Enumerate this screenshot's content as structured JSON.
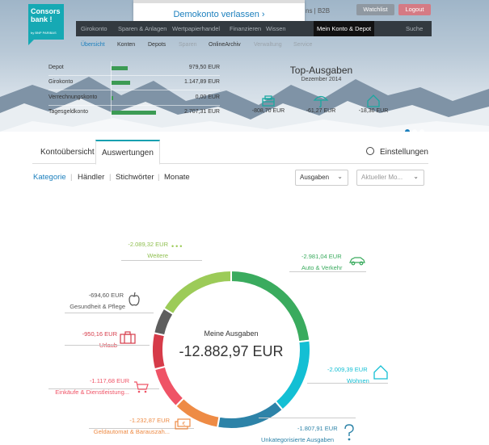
{
  "header": {
    "logo_line1": "Consors",
    "logo_line2": "bank !",
    "logo_sub": "by BNP PARIBAS",
    "demo_link": "Demokonto verlassen",
    "top_links": "ns | B2B",
    "watchlist": "Watchlist",
    "logout": "Logout",
    "main_nav": [
      "Girokonto",
      "Sparen & Anlagen",
      "Wertpapierhandel",
      "Finanzieren",
      "Wissen",
      "Mein Konto & Depot",
      "Suche"
    ],
    "sub_nav": [
      "Übersicht",
      "Konten",
      "Depots",
      "Sparen",
      "OnlineArchiv",
      "Verwaltung",
      "Service"
    ],
    "accounts": [
      {
        "name": "Depot",
        "value": "979,50 EUR",
        "share": 0.36
      },
      {
        "name": "Girokonto",
        "value": "1.147,89 EUR",
        "share": 0.42
      },
      {
        "name": "Verrechnungskonto",
        "value": "0,00 EUR",
        "share": 0.02
      },
      {
        "name": "Tagesgeldkonto",
        "value": "2.707,31 EUR",
        "share": 1.0
      }
    ],
    "top_ausgaben_title": "Top-Ausgaben",
    "top_ausgaben_month": "Dezember 2014",
    "top_ausgaben": [
      {
        "icon": "money-icon",
        "value": "-808,70 EUR"
      },
      {
        "icon": "umbrella-icon",
        "value": "-61,27 EUR"
      },
      {
        "icon": "house-icon",
        "value": "-18,30 EUR"
      }
    ]
  },
  "tabs": {
    "overview": "Kontoübersicht",
    "analysis": "Auswertungen",
    "settings": "Einstellungen"
  },
  "filters": {
    "items": [
      "Kategorie",
      "Händler",
      "Stichwörter",
      "Monate"
    ],
    "type_select": "Ausgaben",
    "month_placeholder": "Aktueller Mo..."
  },
  "chart_data": {
    "type": "donut",
    "title": "Meine Ausgaben",
    "total": "-12.882,97 EUR",
    "total_value": -12882.97,
    "slices": [
      {
        "name": "Auto & Verkehr",
        "label": "-2.981,04 EUR",
        "value": 2981.04,
        "color": "#3aab5e"
      },
      {
        "name": "Wohnen",
        "label": "-2.009,39 EUR",
        "value": 2009.39,
        "color": "#13bfd4"
      },
      {
        "name": "Unkategorisierte Ausgaben",
        "label": "-1.807,91 EUR",
        "value": 1807.91,
        "color": "#2d83a8"
      },
      {
        "name": "Geldautomat & Barauszah...",
        "label": "-1.232,87 EUR",
        "value": 1232.87,
        "color": "#ee8b45"
      },
      {
        "name": "Einkäufe & Dienstleistung...",
        "label": "-1.117,68 EUR",
        "value": 1117.68,
        "color": "#ef5366"
      },
      {
        "name": "Urlaub",
        "label": "-950,16 EUR",
        "value": 950.16,
        "color": "#d63b49"
      },
      {
        "name": "Gesundheit & Pflege",
        "label": "-694,60 EUR",
        "value": 694.6,
        "color": "#5e5e5e"
      },
      {
        "name": "Weitere",
        "label": "-2.089,32 EUR",
        "value": 2089.32,
        "color": "#9ccb58"
      }
    ]
  }
}
